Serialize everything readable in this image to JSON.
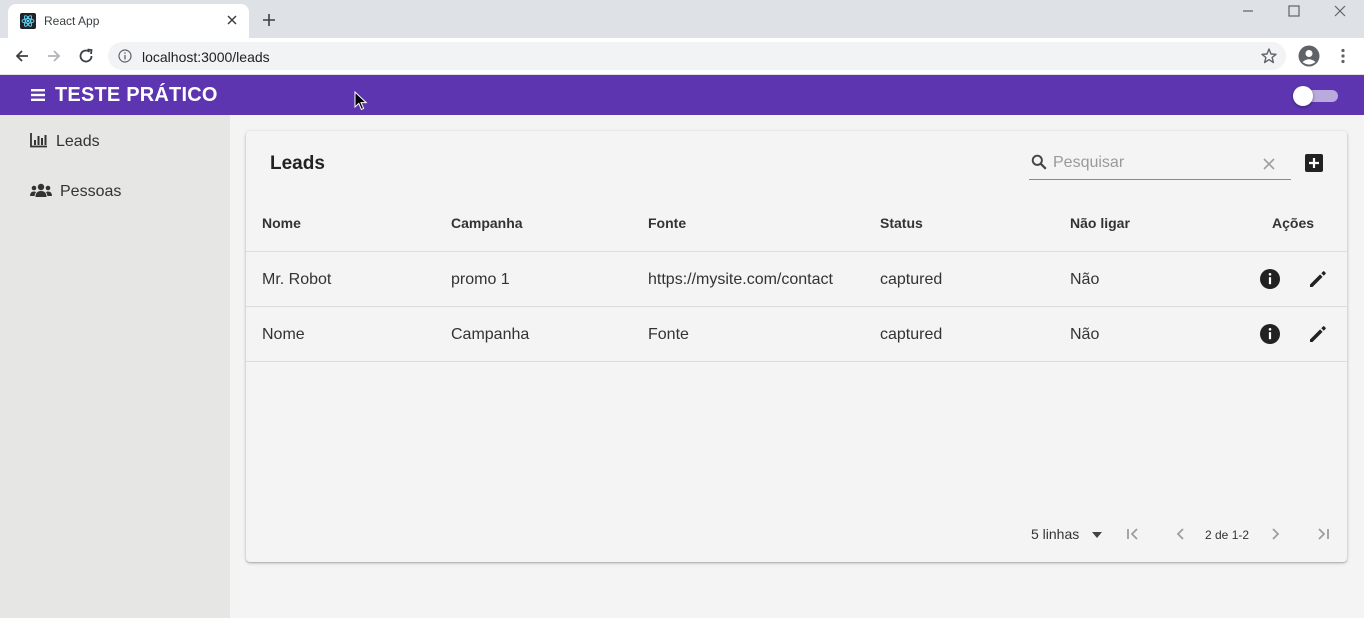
{
  "browser": {
    "tab_title": "React App",
    "url": "localhost:3000/leads"
  },
  "appbar": {
    "title": "TESTE PRÁTICO",
    "theme_toggle_on": false
  },
  "sidebar": {
    "items": [
      {
        "label": "Leads",
        "icon": "bar-chart-icon"
      },
      {
        "label": "Pessoas",
        "icon": "users-icon"
      }
    ]
  },
  "card": {
    "title": "Leads",
    "search": {
      "placeholder": "Pesquisar",
      "value": ""
    },
    "columns": [
      "Nome",
      "Campanha",
      "Fonte",
      "Status",
      "Não ligar",
      "Ações"
    ],
    "rows": [
      {
        "nome": "Mr. Robot",
        "campanha": "promo 1",
        "fonte": "https://mysite.com/contact",
        "status": "captured",
        "nao_ligar": "Não"
      },
      {
        "nome": "Nome",
        "campanha": "Campanha",
        "fonte": "Fonte",
        "status": "captured",
        "nao_ligar": "Não"
      }
    ],
    "pagination": {
      "rows_per_page": "5 linhas",
      "page_info": "2 de 1-2"
    }
  },
  "colors": {
    "appbar": "#5e35b1",
    "sidebar": "#e6e6e5",
    "background": "#f3f4f3"
  }
}
